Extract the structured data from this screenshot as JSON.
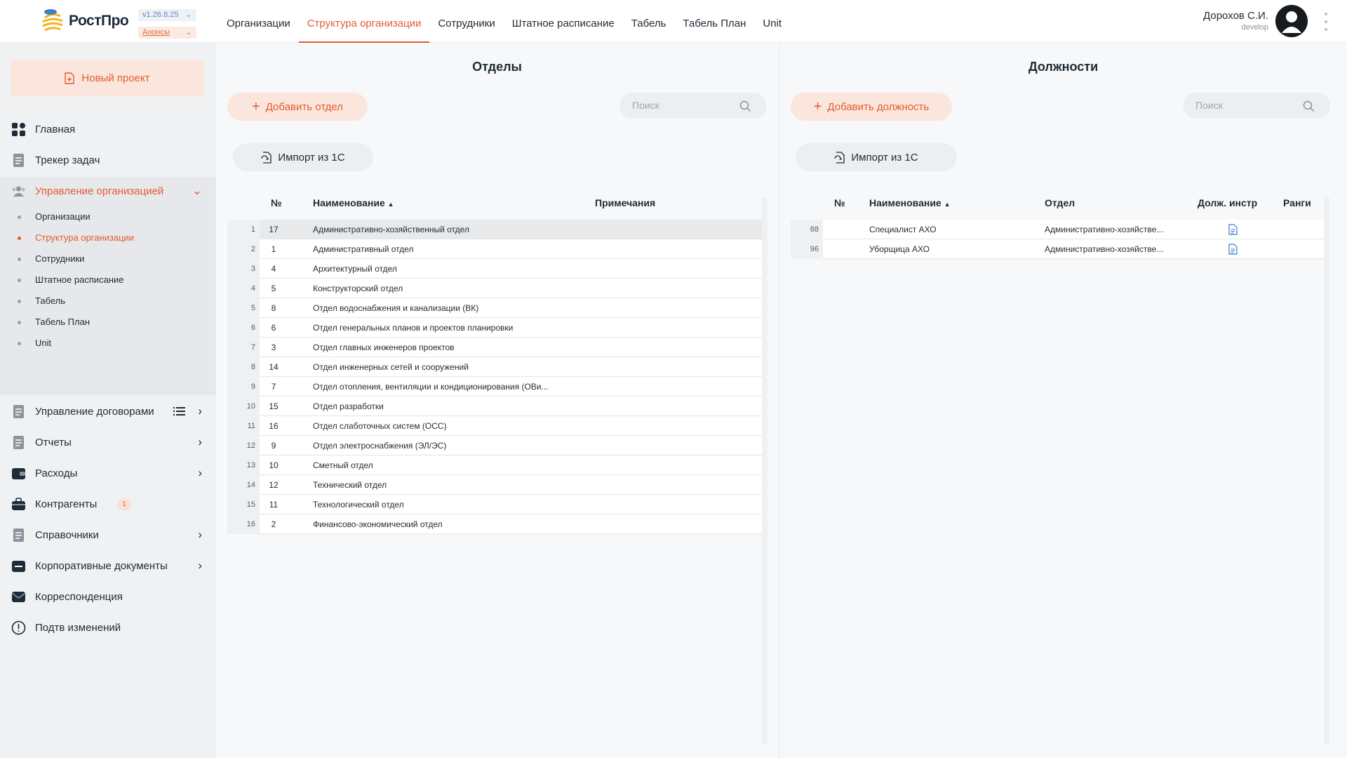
{
  "app": {
    "brand": "РостПро",
    "version": "v1.26.8.25",
    "announcements": "Анонсы"
  },
  "topnav": [
    {
      "label": "Организации"
    },
    {
      "label": "Структура организации",
      "active": true
    },
    {
      "label": "Сотрудники"
    },
    {
      "label": "Штатное расписание"
    },
    {
      "label": "Табель"
    },
    {
      "label": "Табель План"
    },
    {
      "label": "Unit"
    }
  ],
  "user": {
    "name": "Дорохов С.И.",
    "role": "develop"
  },
  "sidebar": {
    "new_project": "Новый проект",
    "items": [
      {
        "label": "Главная",
        "icon": "dashboard-icon"
      },
      {
        "label": "Трекер задач",
        "icon": "tasks-icon"
      },
      {
        "label": "Управление организацией",
        "icon": "users-icon",
        "expanded": true
      },
      {
        "label": "Управление договорами",
        "icon": "contract-icon"
      },
      {
        "label": "Отчеты",
        "icon": "report-icon"
      },
      {
        "label": "Расходы",
        "icon": "wallet-icon"
      },
      {
        "label": "Контрагенты",
        "icon": "briefcase-icon",
        "badge": "1"
      },
      {
        "label": "Справочники",
        "icon": "book-icon"
      },
      {
        "label": "Корпоративные документы",
        "icon": "folder-icon"
      },
      {
        "label": "Корреспонденция",
        "icon": "mail-icon"
      },
      {
        "label": "Подтв изменений",
        "icon": "alert-icon"
      }
    ],
    "sub_items": [
      {
        "label": "Организации"
      },
      {
        "label": "Структура организации",
        "active": true
      },
      {
        "label": "Сотрудники"
      },
      {
        "label": "Штатное расписание"
      },
      {
        "label": "Табель"
      },
      {
        "label": "Табель План"
      },
      {
        "label": "Unit"
      }
    ]
  },
  "departments": {
    "title": "Отделы",
    "add_label": "Добавить отдел",
    "search_placeholder": "Поиск",
    "import_label": "Импорт из 1С",
    "columns": {
      "num": "№",
      "name": "Наименование",
      "notes": "Примечания"
    },
    "rows": [
      {
        "idx": "1",
        "num": "17",
        "name": "Административно-хозяйственный отдел",
        "selected": true
      },
      {
        "idx": "2",
        "num": "1",
        "name": "Административный отдел"
      },
      {
        "idx": "3",
        "num": "4",
        "name": "Архитектурный отдел"
      },
      {
        "idx": "4",
        "num": "5",
        "name": "Конструкторский отдел"
      },
      {
        "idx": "5",
        "num": "8",
        "name": "Отдел водоснабжения и канализации (ВК)"
      },
      {
        "idx": "6",
        "num": "6",
        "name": "Отдел генеральных планов и проектов планировки"
      },
      {
        "idx": "7",
        "num": "3",
        "name": "Отдел главных инженеров проектов"
      },
      {
        "idx": "8",
        "num": "14",
        "name": "Отдел инженерных сетей и сооружений"
      },
      {
        "idx": "9",
        "num": "7",
        "name": "Отдел отопления, вентиляции и кондиционирования (ОВи..."
      },
      {
        "idx": "10",
        "num": "15",
        "name": "Отдел разработки"
      },
      {
        "idx": "11",
        "num": "16",
        "name": "Отдел слаботочных систем (ОСС)"
      },
      {
        "idx": "12",
        "num": "9",
        "name": "Отдел электроснабжения (ЭЛ/ЭС)"
      },
      {
        "idx": "13",
        "num": "10",
        "name": "Сметный отдел"
      },
      {
        "idx": "14",
        "num": "12",
        "name": "Технический отдел"
      },
      {
        "idx": "15",
        "num": "11",
        "name": "Технологический отдел"
      },
      {
        "idx": "16",
        "num": "2",
        "name": "Финансово-экономический отдел"
      }
    ]
  },
  "positions": {
    "title": "Должности",
    "add_label": "Добавить должность",
    "search_placeholder": "Поиск",
    "import_label": "Импорт из 1С",
    "columns": {
      "num": "№",
      "name": "Наименование",
      "dept": "Отдел",
      "instr": "Долж. инстр",
      "ranks": "Ранги"
    },
    "rows": [
      {
        "idx": "88",
        "name": "Специалист АХО",
        "dept": "Административно-хозяйстве...",
        "has_instr": true
      },
      {
        "idx": "96",
        "name": "Уборщица АХО",
        "dept": "Административно-хозяйстве...",
        "has_instr": true
      }
    ]
  },
  "colors": {
    "accent": "#e25d2f",
    "accent_light": "#fbe6de",
    "sidebar_bg": "#f0f1f3",
    "text": "#1f2a33"
  }
}
